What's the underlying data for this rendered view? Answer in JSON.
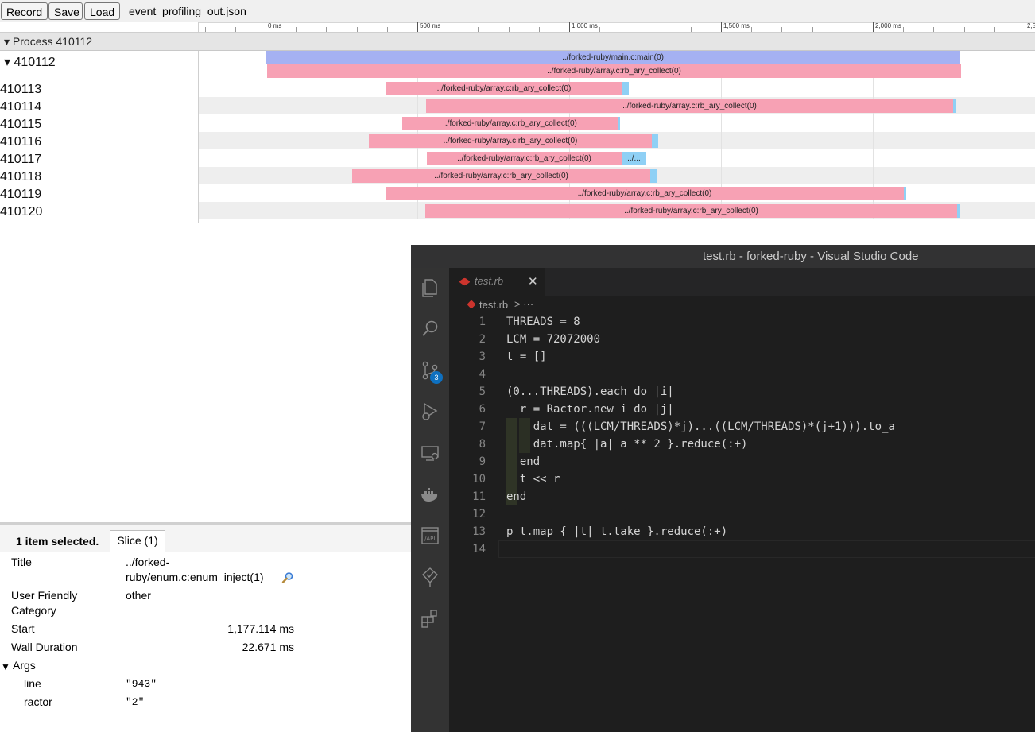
{
  "toolbar": {
    "record_label": "Record",
    "save_label": "Save",
    "load_label": "Load",
    "filename": "event_profiling_out.json"
  },
  "ruler": {
    "labels": [
      "0 ms",
      "500 ms",
      "1,000 ms",
      "1,500 ms",
      "2,000 ms",
      "2,5"
    ]
  },
  "process": {
    "header": "▾ Process 410112",
    "main_thread": "▾  410112",
    "threads": [
      "410113",
      "410114",
      "410115",
      "410116",
      "410117",
      "410118",
      "410119",
      "410120"
    ]
  },
  "slices": {
    "main": "../forked-ruby/main.c:main(0)",
    "collect": "../forked-ruby/array.c:rb_ary_collect(0)",
    "short": "../..."
  },
  "details": {
    "selected_count": "1 item selected.",
    "tab_label": "Slice (1)",
    "title_label": "Title",
    "title_value_line1": "../forked-",
    "title_value_line2": "ruby/enum.c:enum_inject(1)",
    "category_label_line1": "User Friendly",
    "category_label_line2": "Category",
    "category_value": "other",
    "start_label": "Start",
    "start_value": "1,177.114 ms",
    "duration_label": "Wall Duration",
    "duration_value": "22.671 ms",
    "args_label": "Args",
    "args": [
      {
        "key": "line",
        "value": "\"943\""
      },
      {
        "key": "ractor",
        "value": "\"2\""
      }
    ]
  },
  "vscode": {
    "window_title": "test.rb - forked-ruby - Visual Studio Code",
    "tab_name": "test.rb",
    "breadcrumb_file": "test.rb",
    "breadcrumb_more": "> ···",
    "scm_badge": "3",
    "line_numbers": [
      "1",
      "2",
      "3",
      "4",
      "5",
      "6",
      "7",
      "8",
      "9",
      "10",
      "11",
      "12",
      "13",
      "14"
    ],
    "code_lines": [
      "THREADS = 8",
      "LCM = 72072000",
      "t = []",
      "",
      "(0...THREADS).each do |i|",
      "  r = Ractor.new i do |j|",
      "    dat = (((LCM/THREADS)*j)...((LCM/THREADS)*(j+1))).to_a",
      "    dat.map{ |a| a ** 2 }.reduce(:+)",
      "  end",
      "  t << r",
      "end",
      "",
      "p t.map { |t| t.take }.reduce(:+)",
      ""
    ],
    "activity_icons": [
      "explorer-icon",
      "search-icon",
      "source-control-icon",
      "run-debug-icon",
      "remote-explorer-icon",
      "docker-icon",
      "api-icon",
      "testing-icon",
      "extensions-icon"
    ]
  }
}
